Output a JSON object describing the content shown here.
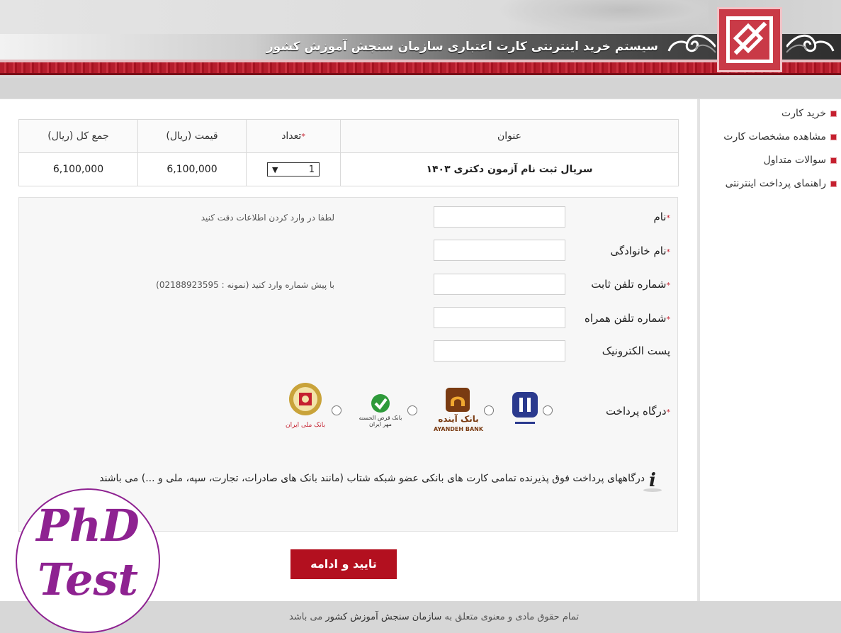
{
  "header": {
    "title": "سیستم خرید اینترنتی کارت اعتباری سازمان سنجش آموزش کشور"
  },
  "sidebar": {
    "items": [
      {
        "label": "خرید کارت"
      },
      {
        "label": "مشاهده مشخصات کارت"
      },
      {
        "label": "سوالات متداول"
      },
      {
        "label": "راهنمای پرداخت اینترنتی"
      }
    ]
  },
  "cart": {
    "headers": {
      "title": "عنوان",
      "quantity": "تعداد",
      "price": "قیمت (ریال)",
      "total": "جمع کل (ریال)"
    },
    "row": {
      "title": "سریال ثبت نام آزمون دکتری ۱۴۰۳",
      "quantity": "1",
      "price": "6,100,000",
      "total": "6,100,000"
    }
  },
  "form": {
    "first_name_label": "نام",
    "first_name_hint": "لطفا در وارد کردن اطلاعات دقت کنید",
    "last_name_label": "نام خانوادگی",
    "phone_label": "شماره تلفن ثابت",
    "phone_hint": "با پیش شماره وارد کنید (نمونه : 02188923595)",
    "mobile_label": "شماره تلفن همراه",
    "email_label": "پست الکترونیک",
    "gateway_label": "درگاه پرداخت",
    "banks": {
      "ayandeh": "بانک آینده",
      "ayandeh_en": "AYANDEH BANK",
      "mehr": "بانک قرض الحسنه مهر ایران",
      "melli": "بانک ملی ایران"
    },
    "info_text": "درگاههای پرداخت فوق پذیرنده تمامی کارت های بانکی عضو شبکه شتاب (مانند بانک های صادرات، تجارت، سپه، ملی و ...) می باشند",
    "submit_label": "تایید و ادامه"
  },
  "footer": {
    "prefix": "تمام حقوق مادی و معنوی متعلق به",
    "org": "سازمان سنجش آموزش کشور",
    "suffix": "می باشد"
  },
  "watermark": {
    "line1": "PhD",
    "line2": "Test"
  },
  "colors": {
    "brand_red": "#b3101f",
    "watermark_purple": "#8e2291"
  }
}
